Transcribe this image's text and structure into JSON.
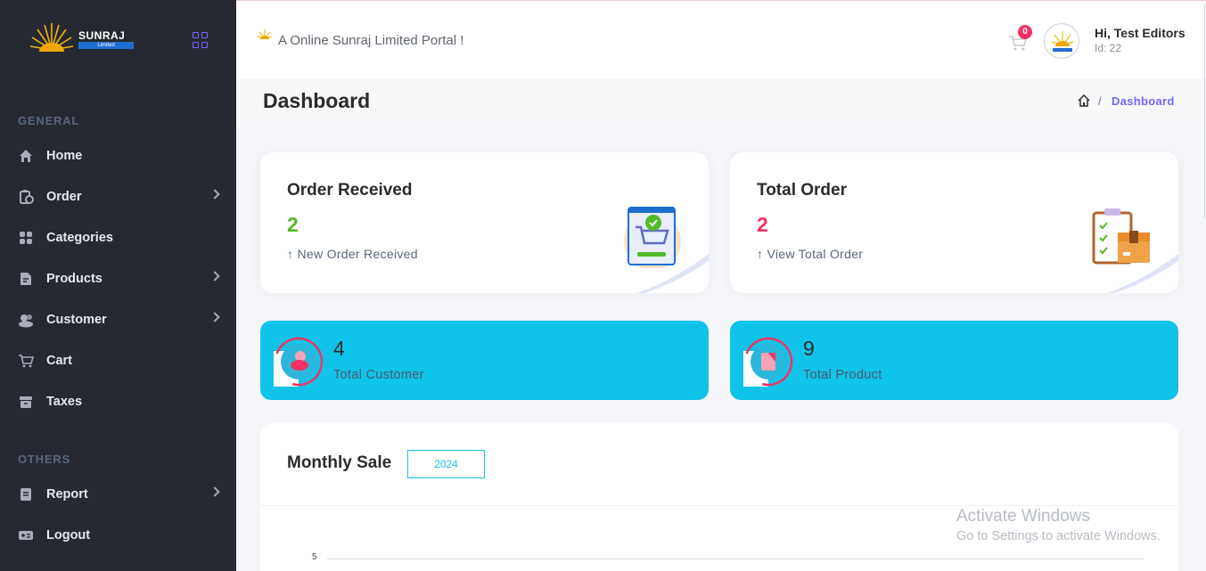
{
  "sidebar": {
    "logo_text": "SUNRAJ",
    "logo_sub": "Limited",
    "sections": [
      {
        "title": "GENERAL",
        "items": [
          {
            "label": "Home",
            "icon": "home-icon",
            "has_children": false
          },
          {
            "label": "Order",
            "icon": "order-icon",
            "has_children": true
          },
          {
            "label": "Categories",
            "icon": "categories-icon",
            "has_children": false
          },
          {
            "label": "Products",
            "icon": "products-icon",
            "has_children": true
          },
          {
            "label": "Customer",
            "icon": "customer-icon",
            "has_children": true
          },
          {
            "label": "Cart",
            "icon": "cart-icon",
            "has_children": false
          },
          {
            "label": "Taxes",
            "icon": "taxes-icon",
            "has_children": false
          }
        ]
      },
      {
        "title": "OTHERS",
        "items": [
          {
            "label": "Report",
            "icon": "report-icon",
            "has_children": true
          },
          {
            "label": "Logout",
            "icon": "logout-icon",
            "has_children": false
          }
        ]
      }
    ]
  },
  "header": {
    "portal_text": "A Online Sunraj Limited Portal !",
    "cart_count": "0",
    "user_greeting": "Hi, Test Editors",
    "user_id": "Id: 22"
  },
  "page": {
    "title": "Dashboard",
    "breadcrumb_current": "Dashboard",
    "breadcrumb_separator": "/"
  },
  "cards": [
    {
      "title": "Order Received",
      "value": "2",
      "value_color": "#51bb25",
      "sub": "↑ New Order Received"
    },
    {
      "title": "Total Order",
      "value": "2",
      "value_color": "#f73164",
      "sub": "↑ View Total Order"
    }
  ],
  "stats": [
    {
      "value": "4",
      "label": "Total Customer"
    },
    {
      "value": "9",
      "label": "Total Product"
    }
  ],
  "monthly_sale": {
    "title": "Monthly Sale",
    "year": "2024",
    "axis_tick": "5"
  },
  "activation": {
    "title": "Activate Windows",
    "subtitle": "Go to Settings to activate Windows."
  },
  "colors": {
    "sidebar_bg": "#262932",
    "accent": "#7366ff",
    "stat_bg": "#10c3e8",
    "badge": "#f73164"
  }
}
